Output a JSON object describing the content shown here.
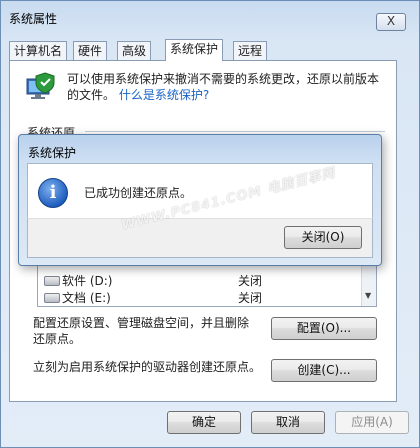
{
  "window": {
    "title": "系统属性",
    "close_label": "X"
  },
  "tabs": [
    "计算机名",
    "硬件",
    "高级",
    "系统保护",
    "远程"
  ],
  "intro": {
    "text": "可以使用系统保护来撤消不需要的系统更改，还原以前版本的文件。",
    "link": "什么是系统保护?"
  },
  "section_title": "系统还原",
  "drives": [
    {
      "name": "软件 (D:)",
      "status": "关闭"
    },
    {
      "name": "文档 (E:)",
      "status": "关闭"
    }
  ],
  "configure": {
    "description": "配置还原设置、管理磁盘空间，并且删除还原点。",
    "button": "配置(O)..."
  },
  "create": {
    "description": "立刻为启用系统保护的驱动器创建还原点。",
    "button": "创建(C)..."
  },
  "footer": {
    "ok": "确定",
    "cancel": "取消",
    "apply": "应用(A)"
  },
  "dialog": {
    "title": "系统保护",
    "message": "已成功创建还原点。",
    "close_button": "关闭(O)"
  },
  "watermark": "WWW.PC841.COM 电脑百事网",
  "icons": {
    "shield": "system-protection-shield-icon",
    "info": "info-icon",
    "drive": "drive-icon"
  }
}
